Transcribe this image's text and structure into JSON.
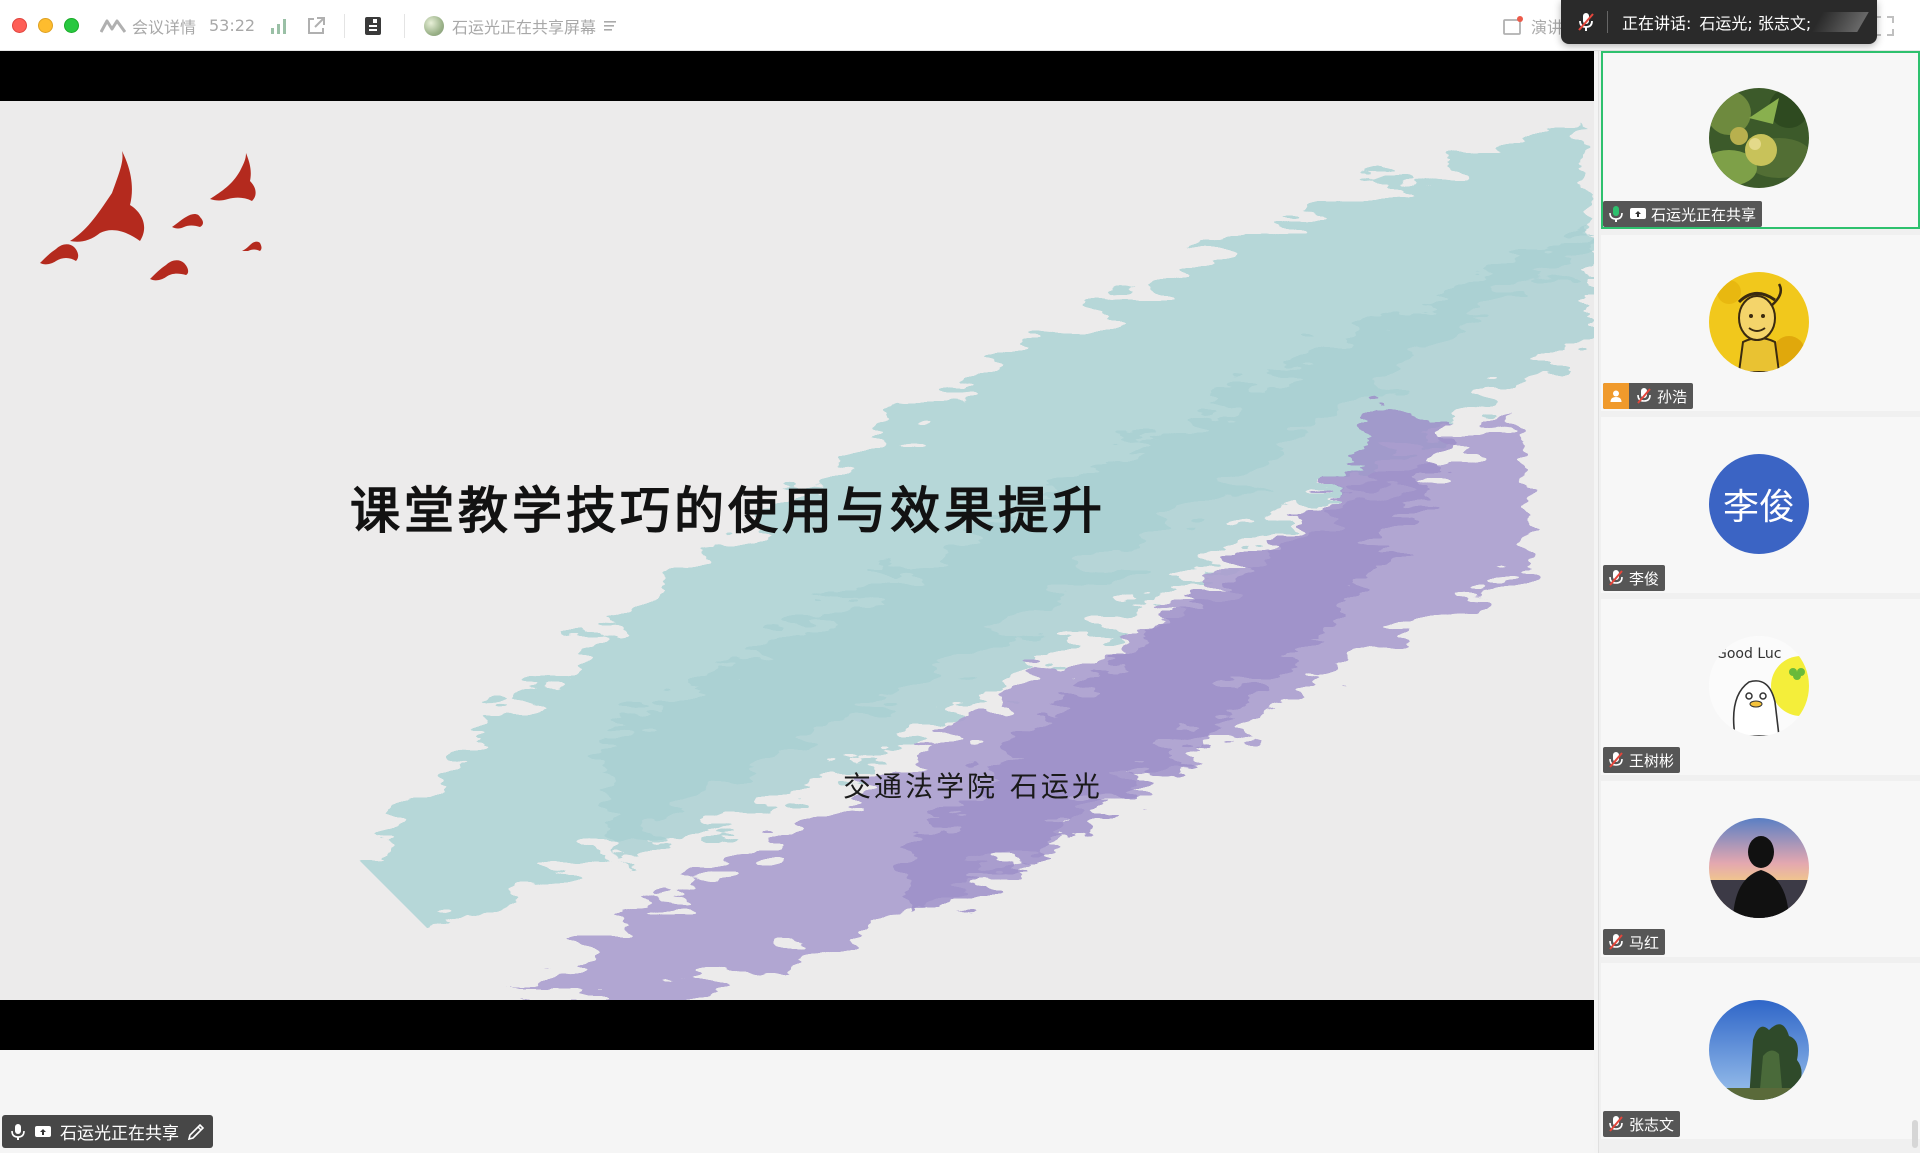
{
  "window": {
    "meeting_details_label": "会议详情",
    "elapsed_time": "53:22",
    "sharing_status": "石运光正在共享屏幕",
    "present_label": "演讲"
  },
  "speaking": {
    "label": "正在讲话:",
    "names": "石运光; 张志文;"
  },
  "slide": {
    "title": "课堂教学技巧的使用与效果提升",
    "subtitle": "交通法学院  石运光"
  },
  "bottom_label": {
    "text": "石运光正在共享"
  },
  "participants": [
    {
      "name": "石运光正在共享",
      "avatar": "peach-photo",
      "active": true
    },
    {
      "name": "孙浩",
      "avatar": "cartoon-man",
      "host": true
    },
    {
      "name": "李俊",
      "avatar": "initials",
      "initials": "李俊"
    },
    {
      "name": "王树彬",
      "avatar": "good-luck-cartoon",
      "avatar_text": "Good Luc"
    },
    {
      "name": "马红",
      "avatar": "silhouette-sunset"
    },
    {
      "name": "张志文",
      "avatar": "tree-sky"
    }
  ],
  "colors": {
    "active_border": "#2ec16e",
    "host_badge": "#f09a2c",
    "initials_avatar": "#3b64c4",
    "bird_red": "#b42a1e"
  }
}
